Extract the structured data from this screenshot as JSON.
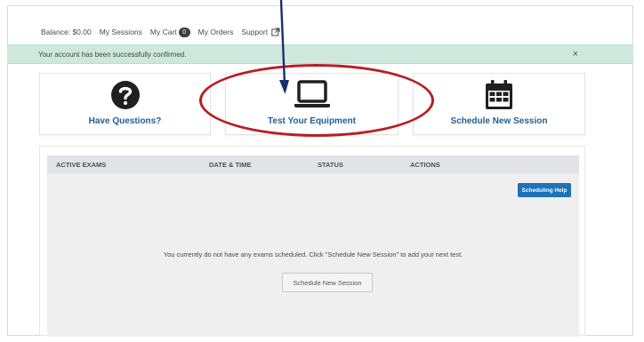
{
  "nav": {
    "balance": "Balance: $0.00",
    "sessions": "My Sessions",
    "cart": "My Cart",
    "cart_count": "0",
    "orders": "My Orders",
    "support": "Support"
  },
  "alert": {
    "message": "Your account has been successfully confirmed.",
    "close": "×"
  },
  "cards": {
    "questions": "Have Questions?",
    "test": "Test Your Equipment",
    "schedule": "Schedule New Session"
  },
  "table": {
    "headers": [
      "ACTIVE EXAMS",
      "DATE & TIME",
      "STATUS",
      "ACTIONS"
    ],
    "help_button": "Scheduling Help",
    "empty_message": "You currently do not have any exams scheduled. Click \"Schedule New Session\" to add your next test.",
    "schedule_button": "Schedule New Session"
  },
  "colors": {
    "link": "#1f5f93",
    "alert_bg": "#cfe8de",
    "primary_button": "#1d72b8",
    "annotation_circle": "#b81e23",
    "annotation_arrow": "#1c2f6b"
  },
  "icons": {
    "questions": "question-circle-icon",
    "test": "laptop-icon",
    "schedule": "calendar-icon",
    "support": "external-link-icon"
  }
}
